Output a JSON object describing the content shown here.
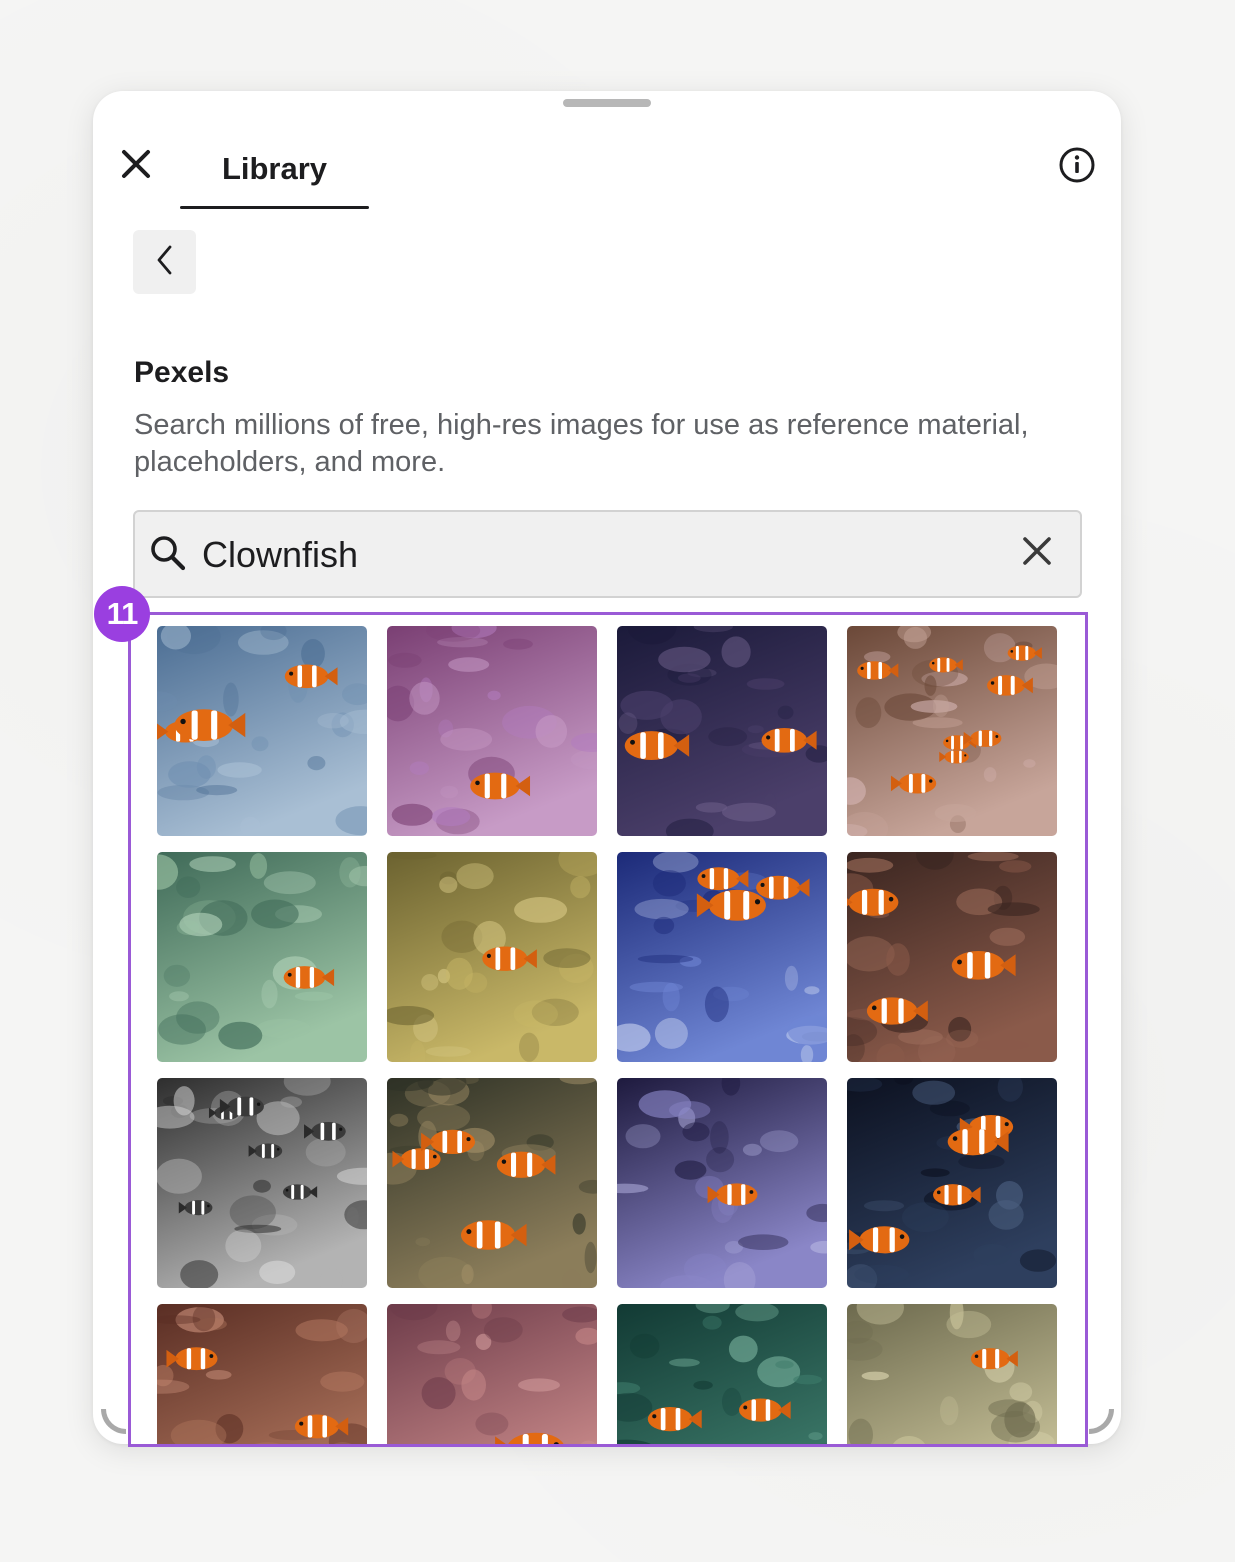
{
  "header": {
    "tab_label": "Library"
  },
  "section": {
    "title": "Pexels",
    "description": "Search millions of free, high-res images for use as reference material, placeholders, and more."
  },
  "search": {
    "value": "Clownfish"
  },
  "annotation": {
    "badge_number": "11",
    "color": "#9a3fe0"
  },
  "icons": {
    "close": "close-icon",
    "info": "info-icon",
    "back": "chevron-left-icon",
    "search": "search-icon",
    "clear": "clear-icon"
  },
  "results": {
    "tiles": [
      {
        "name": "clownfish-on-blue-reef",
        "bg": [
          "#4b6d93",
          "#a9bfd4"
        ],
        "accent": "#6f8fb1",
        "fish": 3
      },
      {
        "name": "clownfish-in-purple-anemone",
        "bg": [
          "#7a3f73",
          "#c79bc6"
        ],
        "accent": "#b27cc0",
        "fish": 1
      },
      {
        "name": "clownfish-dark-aquarium",
        "bg": [
          "#1b1a3a",
          "#4b3f6a"
        ],
        "accent": "#6a5c86",
        "fish": 2
      },
      {
        "name": "many-clownfish-coral",
        "bg": [
          "#6b4838",
          "#c7a59a"
        ],
        "accent": "#d9b9b9",
        "fish": 8
      },
      {
        "name": "clownfish-green-anemone",
        "bg": [
          "#3f6a58",
          "#9cc4a5"
        ],
        "accent": "#b8d8bf",
        "fish": 1
      },
      {
        "name": "clownfish-yellow-anemone",
        "bg": [
          "#6b6230",
          "#c9b868"
        ],
        "accent": "#d6c784",
        "fish": 1
      },
      {
        "name": "clownfish-blue-tank",
        "bg": [
          "#1c2a78",
          "#6f86d4"
        ],
        "accent": "#c6d0ef",
        "fish": 3
      },
      {
        "name": "clownfish-brown-reef",
        "bg": [
          "#3a2520",
          "#8a5a4a"
        ],
        "accent": "#9d6d5b",
        "fish": 3
      },
      {
        "name": "clownfish-black-and-white",
        "bg": [
          "#2e2e2e",
          "#b3b3b3"
        ],
        "accent": "#d9d9d9",
        "fish": 6
      },
      {
        "name": "clownfish-anemone-cluster",
        "bg": [
          "#2f3226",
          "#8b7d5a"
        ],
        "accent": "#b09b70",
        "fish": 4
      },
      {
        "name": "clownfish-purple-sand",
        "bg": [
          "#1e1a3e",
          "#8a86c7"
        ],
        "accent": "#b4b2e0",
        "fish": 1
      },
      {
        "name": "clownfish-dark-blue-water",
        "bg": [
          "#0c1120",
          "#2e3f5e"
        ],
        "accent": "#4b6080",
        "fish": 4
      },
      {
        "name": "clownfish-red-coral",
        "bg": [
          "#5a2e24",
          "#b0765e"
        ],
        "accent": "#c9907a",
        "fish": 2
      },
      {
        "name": "clownfish-pink-coral",
        "bg": [
          "#6e3c4a",
          "#c98a8a"
        ],
        "accent": "#d7a0a0",
        "fish": 1
      },
      {
        "name": "clownfish-teal-anemone",
        "bg": [
          "#123a34",
          "#3d7a6a"
        ],
        "accent": "#7fb9a4",
        "fish": 2
      },
      {
        "name": "clownfish-sea-anemone-field",
        "bg": [
          "#6d6a4e",
          "#c9c39a"
        ],
        "accent": "#dcd6b0",
        "fish": 2
      }
    ]
  }
}
